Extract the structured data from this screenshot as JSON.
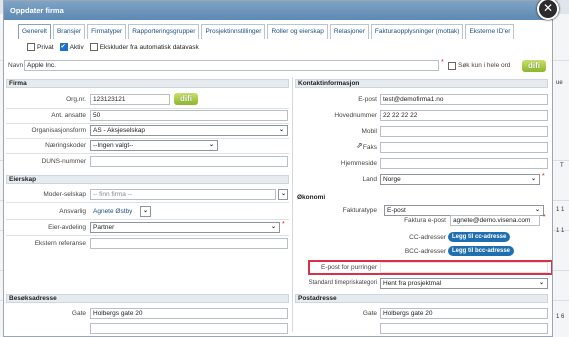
{
  "dialog": {
    "title": "Oppdater firma",
    "close_glyph": "✕"
  },
  "tabs": [
    {
      "label": "Generelt"
    },
    {
      "label": "Bransjer"
    },
    {
      "label": "Firmatyper"
    },
    {
      "label": "Rapporteringsgrupper"
    },
    {
      "label": "Prosjektinnstillinger"
    },
    {
      "label": "Roller og eierskap"
    },
    {
      "label": "Relasjoner"
    },
    {
      "label": "Fakturaopplysninger (mottak)"
    },
    {
      "label": "Eksterne ID'er"
    }
  ],
  "checks": {
    "privat": {
      "label": "Privat",
      "checked": false
    },
    "aktiv": {
      "label": "Aktiv",
      "checked": true
    },
    "ekskluder": {
      "label": "Ekskluder fra automatisk datavask",
      "checked": false
    }
  },
  "navn": {
    "label": "Navn",
    "value": "Apple Inc."
  },
  "sok": {
    "label": "Søk kun i hele ord"
  },
  "difi_label": "difi",
  "firma": {
    "header": "Firma",
    "orgnr": {
      "label": "Org.nr.",
      "value": "123123121"
    },
    "ansatte": {
      "label": "Ant. ansatte",
      "value": "50"
    },
    "orgform": {
      "label": "Organisasjonsform",
      "value": "AS - Aksjeselskap"
    },
    "naering": {
      "label": "Næringskoder",
      "value": "--Ingen valgt--"
    },
    "duns": {
      "label": "DUNS-nummer",
      "value": ""
    }
  },
  "eierskap": {
    "header": "Eierskap",
    "moder": {
      "label": "Moder-selskap",
      "placeholder": "-- finn firma --"
    },
    "ansvarlig": {
      "label": "Ansvarlig",
      "value": "Agnete Østby"
    },
    "eieravd": {
      "label": "Eier-avdeling",
      "value": "Partner"
    },
    "ekstern": {
      "label": "Ekstern referanse",
      "value": ""
    }
  },
  "kontakt": {
    "header": "Kontaktinformasjon",
    "epost": {
      "label": "E-post",
      "value": "test@demofirma1.no"
    },
    "hovednr": {
      "label": "Hovednummer",
      "value": "22 22 22 22"
    },
    "mobil": {
      "label": "Mobil",
      "value": ""
    },
    "faks": {
      "label": "Faks",
      "value": ""
    },
    "hjemmeside": {
      "label": "Hjemmeside",
      "value": ""
    },
    "land": {
      "label": "Land",
      "value": "Norge"
    }
  },
  "okonomi": {
    "header": "Økonomi",
    "fakturatype": {
      "label": "Fakturatype",
      "value": "E-post"
    },
    "faktura_epost": {
      "label": "Faktura e-post",
      "value": "agnete@demo.visena.com"
    },
    "cc": {
      "label": "CC-adresser",
      "button": "Legg til cc-adresse"
    },
    "bcc": {
      "label": "BCC-adresser",
      "button": "Legg til bcc-adresse"
    },
    "purringer": {
      "label": "E-post for purringer",
      "value": ""
    },
    "timepris": {
      "label": "Standard timepriskategori",
      "value": "Hent fra prosjektmal"
    }
  },
  "besok": {
    "header": "Besøksadresse",
    "gate": {
      "label": "Gate",
      "value": "Holbergs gate 20"
    }
  },
  "post": {
    "header": "Postadresse",
    "gate": {
      "label": "Gate",
      "value": "Holbergs gate 20"
    }
  },
  "bg_edge": {
    "t1": "T",
    "t2": "1 1",
    "t3": "1 1",
    "t4": "1 6",
    "t5": "ue"
  },
  "colors": {
    "accent": "#1f6fb0",
    "highlight": "#d8324a",
    "title_bar": "#6e95bd"
  }
}
